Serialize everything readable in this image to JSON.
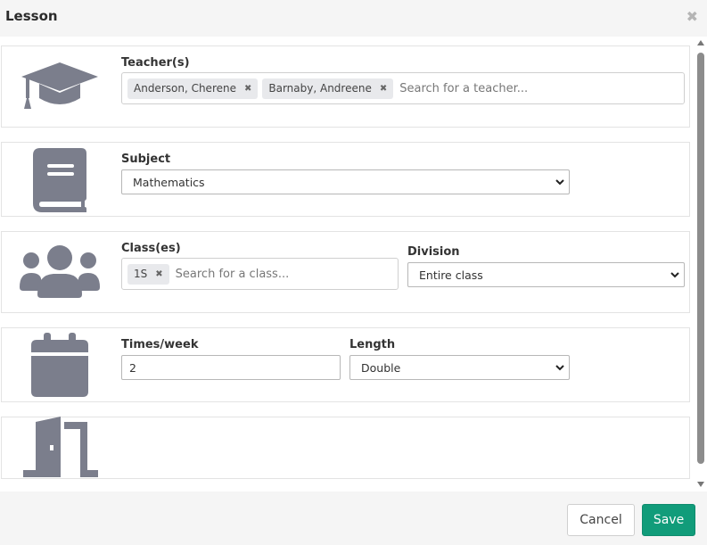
{
  "dialog": {
    "title": "Lesson",
    "close_icon": "close-icon"
  },
  "colors": {
    "icon": "#7b7e8c",
    "accent": "#119c7a",
    "header_bg": "#f5f5f5"
  },
  "teachers": {
    "label": "Teacher(s)",
    "icon": "graduation-cap-icon",
    "tags": [
      "Anderson, Cherene",
      "Barnaby, Andreene"
    ],
    "placeholder": "Search for a teacher..."
  },
  "subject": {
    "label": "Subject",
    "icon": "book-icon",
    "value": "Mathematics"
  },
  "classes": {
    "label": "Class(es)",
    "icon": "users-icon",
    "tags": [
      "1S"
    ],
    "placeholder": "Search for a class..."
  },
  "division": {
    "label": "Division",
    "value": "Entire class"
  },
  "times": {
    "label": "Times/week",
    "icon": "calendar-icon",
    "value": "2"
  },
  "length": {
    "label": "Length",
    "value": "Double"
  },
  "room": {
    "icon": "door-icon"
  },
  "footer": {
    "cancel_label": "Cancel",
    "save_label": "Save"
  }
}
